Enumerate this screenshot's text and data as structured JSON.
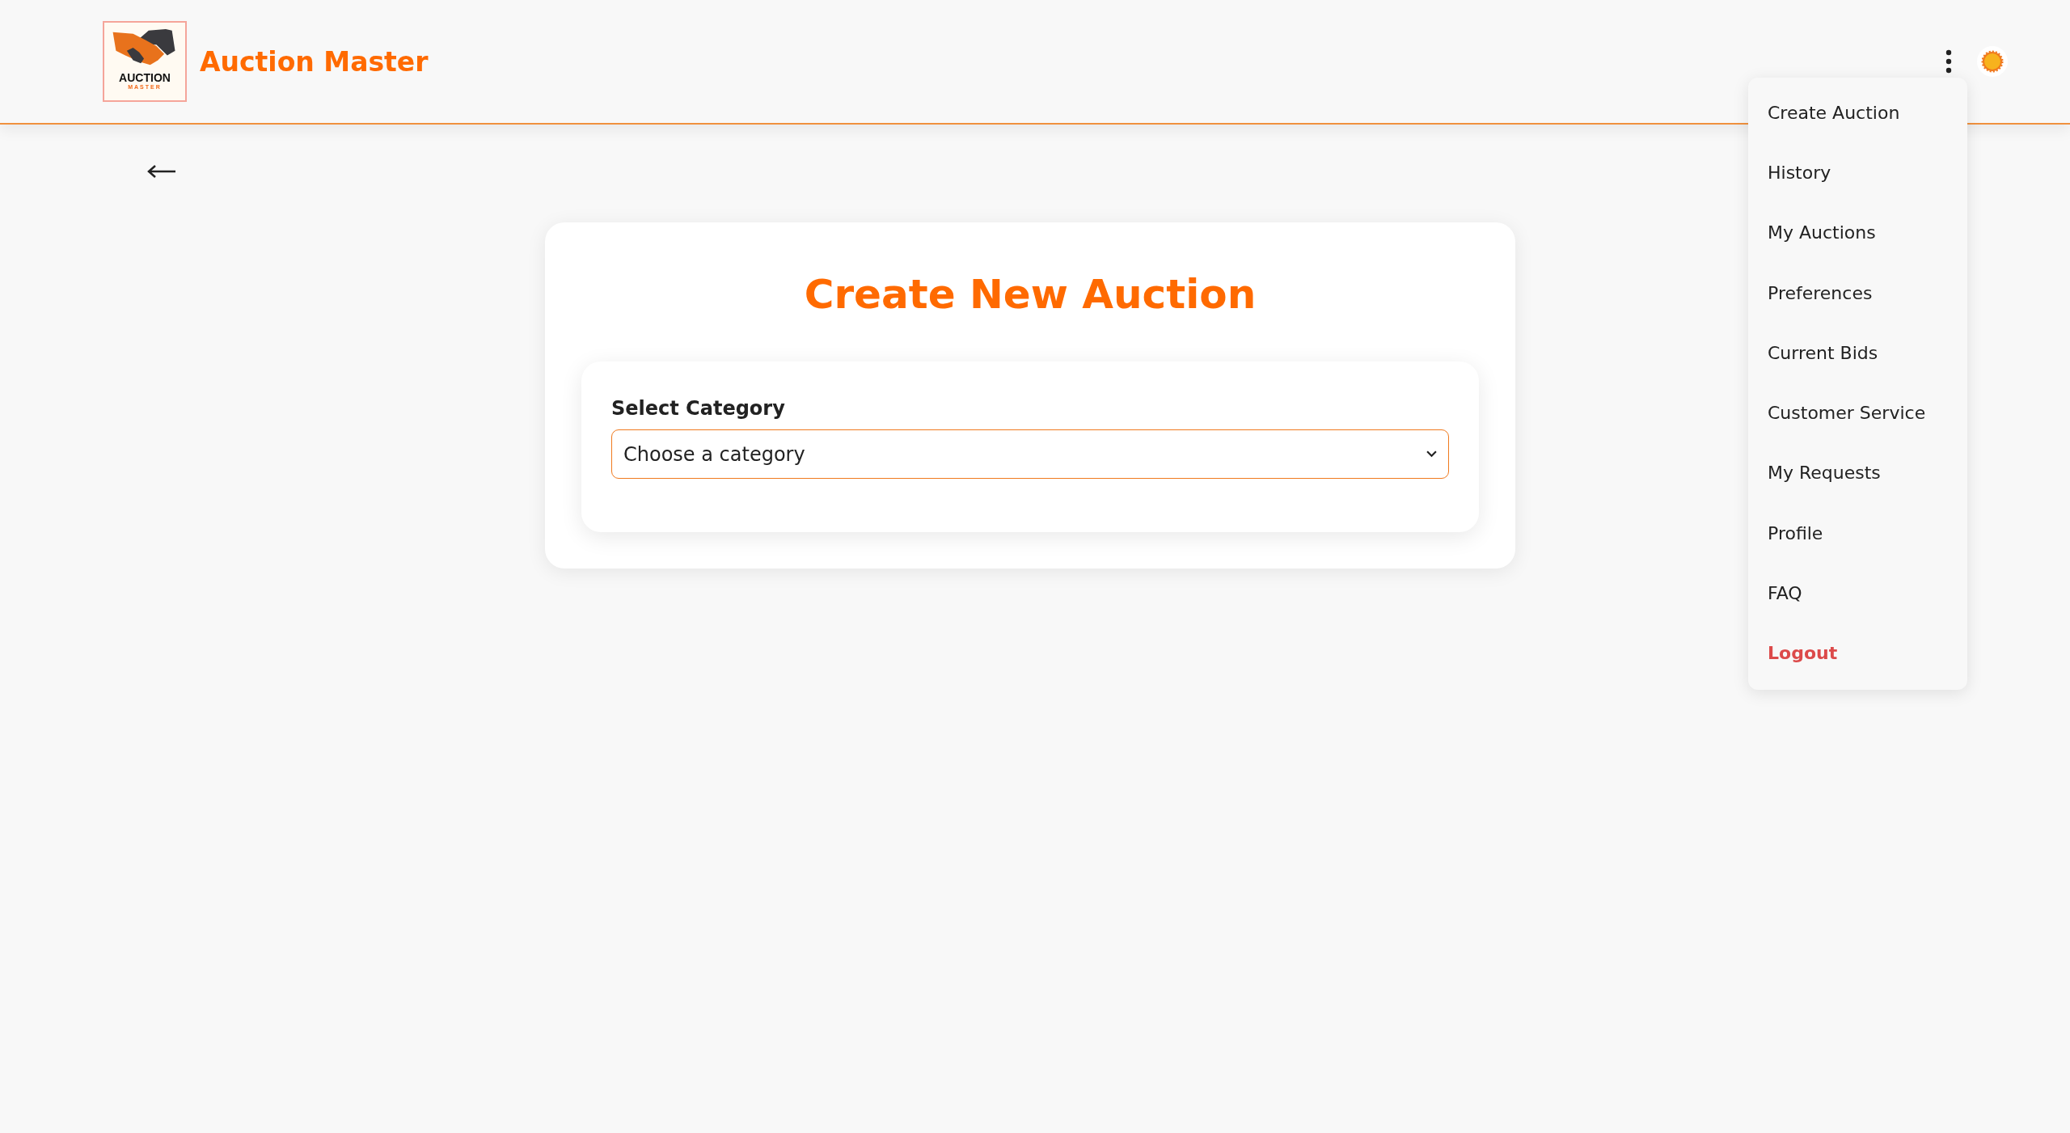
{
  "header": {
    "logo": {
      "line_1": "AUCTION",
      "line_2": "MASTER"
    },
    "brand": "Auction Master"
  },
  "menu": {
    "items": [
      {
        "label": "Create Auction",
        "kind": "normal"
      },
      {
        "label": "History",
        "kind": "normal"
      },
      {
        "label": "My Auctions",
        "kind": "normal"
      },
      {
        "label": "Preferences",
        "kind": "normal"
      },
      {
        "label": "Current Bids",
        "kind": "normal"
      },
      {
        "label": "Customer Service",
        "kind": "normal"
      },
      {
        "label": "My Requests",
        "kind": "normal"
      },
      {
        "label": "Profile",
        "kind": "normal"
      },
      {
        "label": "FAQ",
        "kind": "normal"
      },
      {
        "label": "Logout",
        "kind": "danger"
      }
    ]
  },
  "form": {
    "title": "Create New Auction",
    "category": {
      "label": "Select Category",
      "placeholder": "Choose a category"
    }
  }
}
